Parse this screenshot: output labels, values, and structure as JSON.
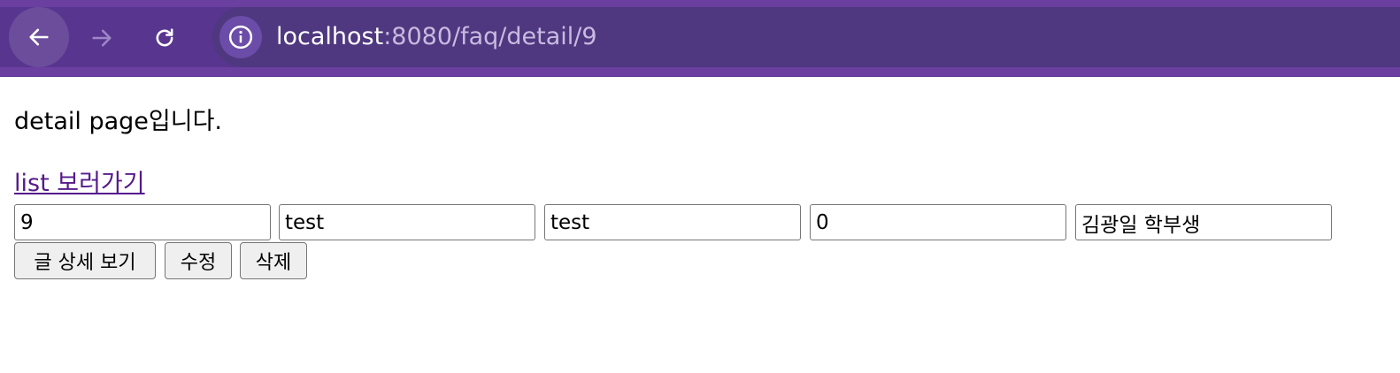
{
  "browser": {
    "url_host": "localhost",
    "url_rest": ":8080/faq/detail/9",
    "toolbar_color": "#6a3fa0"
  },
  "page": {
    "heading": "detail page입니다.",
    "list_link": "list 보러가기",
    "fields": [
      "9",
      "test",
      "test",
      "0",
      "김광일 학부생"
    ],
    "buttons": {
      "detail": "글 상세 보기",
      "edit": "수정",
      "delete": "삭제"
    }
  }
}
